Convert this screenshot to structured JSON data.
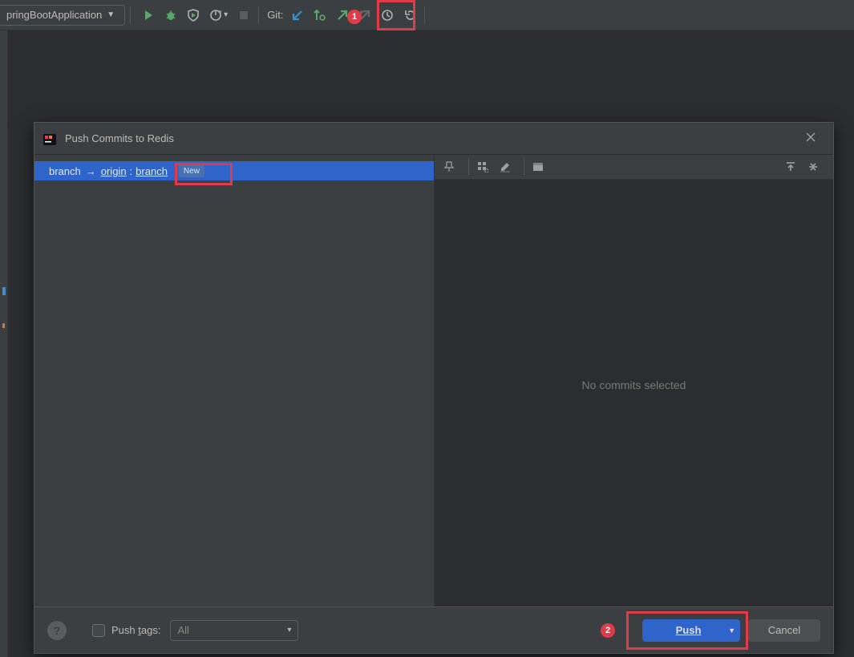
{
  "toolbar": {
    "run_config": "pringBootApplication",
    "git_label": "Git:"
  },
  "annotations": {
    "callout1": "1",
    "callout2": "2"
  },
  "dialog": {
    "title": "Push Commits to Redis",
    "branch_row": {
      "local": "branch",
      "arrow": "→",
      "remote": "origin",
      "colon": ":",
      "target": "branch",
      "new_tag": "New"
    },
    "right": {
      "placeholder": "No commits selected"
    },
    "footer": {
      "help": "?",
      "push_tags_label_pre": "Push ",
      "push_tags_label_ul": "t",
      "push_tags_label_post": "ags:",
      "push_tags_select": "All",
      "push": "Push",
      "cancel": "Cancel"
    }
  }
}
